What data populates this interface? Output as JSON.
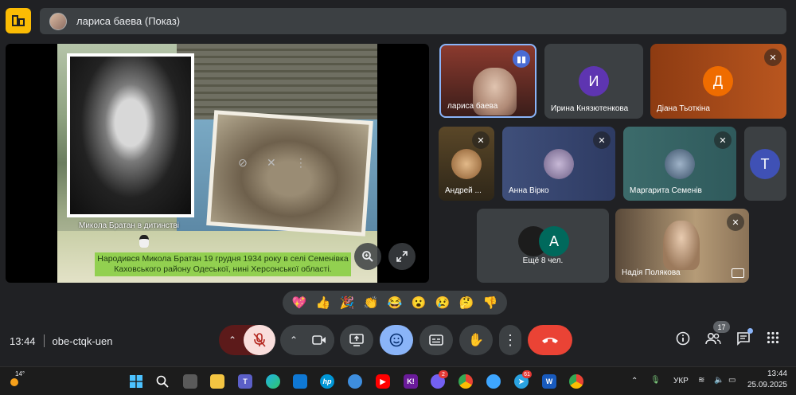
{
  "meeting": {
    "presenter_title": "лариса баева (Показ)",
    "time": "13:44",
    "code": "obe-ctqk-uen",
    "participants_count": "17"
  },
  "slide": {
    "caption": "Микола Братан в дитинстві",
    "text_line1": "Народився Микола Братан 19 грудня 1934 року в селі Семенівка",
    "text_line2": "Каховського району Одеської, нині Херсонської області."
  },
  "tiles": {
    "larisa": {
      "name": "лариса баева"
    },
    "iryna": {
      "name": "Ирина Князютенкова",
      "initial": "И"
    },
    "diana": {
      "name": "Діана Тьоткіна",
      "initial": "Д"
    },
    "andrey": {
      "name": "Андрей ..."
    },
    "anna": {
      "name": "Анна Вірко"
    },
    "marharyta": {
      "name": "Маргарита Семенів"
    },
    "t_tile": {
      "initial": "Т"
    },
    "more": {
      "label": "Ещё 8 чел.",
      "initial": "A"
    },
    "nadiia": {
      "name": "Надія Полякова"
    }
  },
  "reactions": [
    "💖",
    "👍",
    "🎉",
    "👏",
    "😂",
    "😮",
    "😢",
    "🤔",
    "👎"
  ],
  "taskbar": {
    "weather": "14°",
    "lang": "УКР",
    "clock_time": "13:44",
    "clock_date": "25.09.2025",
    "viber_badge": "2",
    "telegram_badge": "61"
  },
  "colors": {
    "background": "#202124",
    "end_call": "#ea4335",
    "mic_off": "#f9dedc",
    "active_reaction": "#8ab4f8",
    "iryna_avatar": "#5e35b1",
    "diana_avatar": "#ef6c00",
    "t_avatar": "#3f51b5",
    "more_avatar": "#00695c"
  }
}
